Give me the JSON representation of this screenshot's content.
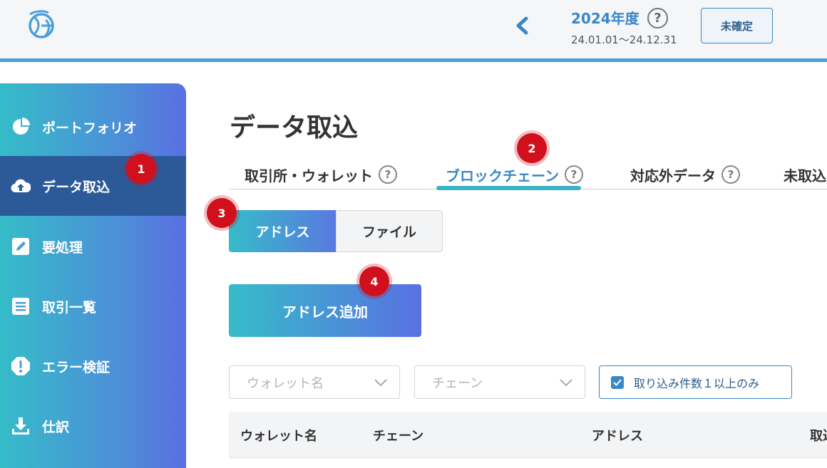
{
  "header": {
    "fiscal_year": "2024年度",
    "help_glyph": "?",
    "fiscal_range": "24.01.01〜24.12.31",
    "status_label": "未確定",
    "logo_icon": "globe-logo-icon",
    "back_icon": "chevron-left-icon"
  },
  "sidebar": {
    "items": [
      {
        "label": "ポートフォリオ",
        "icon": "pie-chart-icon"
      },
      {
        "label": "データ取込",
        "icon": "cloud-upload-icon",
        "active": true
      },
      {
        "label": "要処理",
        "icon": "edit-icon"
      },
      {
        "label": "取引一覧",
        "icon": "list-icon"
      },
      {
        "label": "エラー検証",
        "icon": "alert-octagon-icon"
      },
      {
        "label": "仕訳",
        "icon": "download-icon"
      }
    ]
  },
  "main": {
    "title": "データ取込",
    "tabs": [
      {
        "label": "取引所・ウォレット",
        "help": "?"
      },
      {
        "label": "ブロックチェーン",
        "help": "?",
        "active": true
      },
      {
        "label": "対応外データ",
        "help": "?"
      },
      {
        "label": "未取込"
      }
    ],
    "segments": {
      "address": "アドレス",
      "file": "ファイル",
      "selected": "address"
    },
    "add_button": "アドレス追加",
    "filters": {
      "wallet_placeholder": "ウォレット名",
      "chain_placeholder": "チェーン",
      "nonzero_only_label": "取り込み件数１以上のみ",
      "nonzero_only_checked": true
    },
    "table": {
      "columns": [
        "ウォレット名",
        "チェーン",
        "アドレス",
        "取込"
      ]
    }
  },
  "markers": [
    "1",
    "2",
    "3",
    "4"
  ],
  "colors": {
    "accent_blue": "#3a87c8",
    "sidebar_active": "#2c5a98",
    "gradient_start": "#35bcc9",
    "gradient_end": "#5a70e2",
    "marker_red": "#d0101c"
  }
}
